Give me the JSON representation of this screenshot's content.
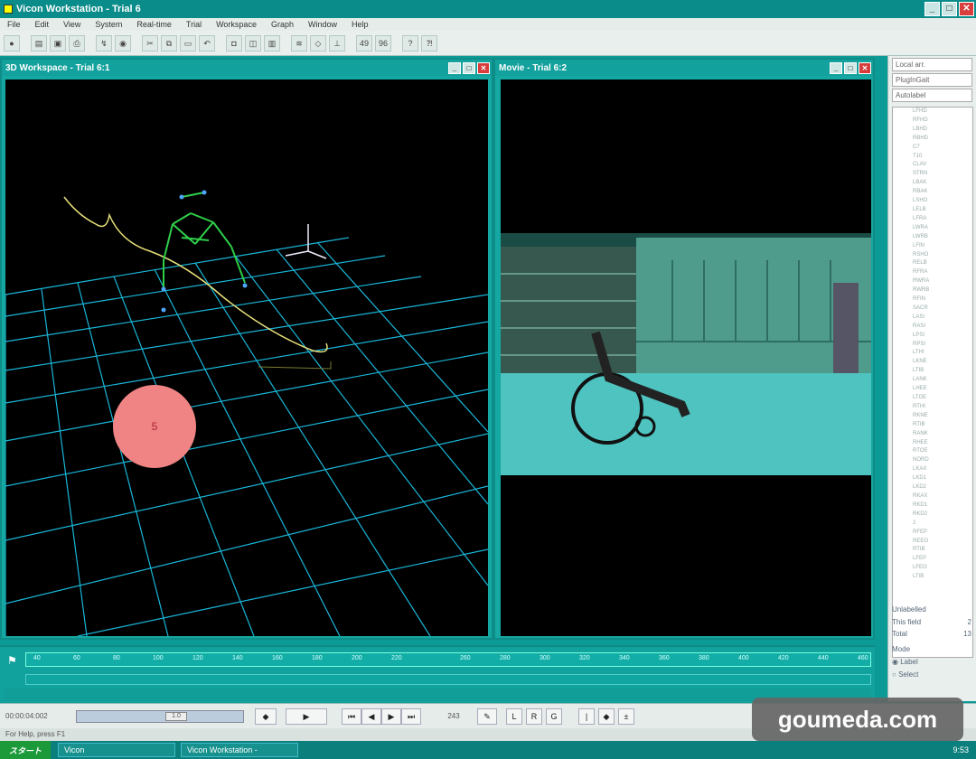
{
  "window": {
    "title": "Vicon Workstation - Trial 6"
  },
  "menu": [
    "File",
    "Edit",
    "View",
    "System",
    "Real-time",
    "Trial",
    "Workspace",
    "Graph",
    "Window",
    "Help"
  ],
  "toolbar": {
    "zoom_a": "49",
    "zoom_b": "96"
  },
  "workspace": {
    "title": "3D Workspace - Trial 6:1",
    "marker_label": "5"
  },
  "movie": {
    "title": "Movie - Trial 6:2"
  },
  "side": {
    "dropdown1": "Local arr.",
    "field": "PlugInGait",
    "dropdown2": "Autolabel",
    "markers": [
      "LFHD",
      "RFHD",
      "LBHD",
      "RBHD",
      "C7",
      "T10",
      "CLAV",
      "STRN",
      "LBAK",
      "RBAK",
      "LSHO",
      "LELB",
      "LFRA",
      "LWRA",
      "LWRB",
      "LFIN",
      "RSHO",
      "RELB",
      "RFRA",
      "RWRA",
      "RWRB",
      "RFIN",
      "SACR",
      "LASI",
      "RASI",
      "LPSI",
      "RPSI",
      "LTHI",
      "LKNE",
      "LTIB",
      "LANK",
      "LHEE",
      "LTOE",
      "RTHI",
      "RKNE",
      "RTIB",
      "RANK",
      "RHEE",
      "RTOE",
      "NORD",
      "LKAX",
      "LKD1",
      "LKD2",
      "RKAX",
      "RKD1",
      "RKD2",
      "2",
      "RFEP",
      "REEO",
      "RTIB",
      "LFEP",
      "LFEO",
      "LTIB"
    ],
    "unlabelled_title": "Unlabelled",
    "this_field_label": "This field",
    "this_field_value": "2",
    "total_label": "Total",
    "total_value": "13",
    "mode_label": "Mode",
    "mode_options": [
      "Label",
      "Select"
    ]
  },
  "timeline": {
    "ticks": [
      "40",
      "60",
      "80",
      "100",
      "120",
      "140",
      "160",
      "180",
      "200",
      "220",
      "260",
      "280",
      "300",
      "320",
      "340",
      "360",
      "380",
      "400",
      "420",
      "440",
      "460"
    ]
  },
  "controls": {
    "timecode": "00:00:04:002",
    "speed": "1.0",
    "frame": "243",
    "buttons": [
      "L",
      "R",
      "G"
    ]
  },
  "status": {
    "text": "For Help, press F1"
  },
  "taskbar": {
    "start": "スタート",
    "task1": "Vicon",
    "task2": "Vicon Workstation -",
    "clock": "9:53"
  },
  "watermark": "goumeda.com"
}
